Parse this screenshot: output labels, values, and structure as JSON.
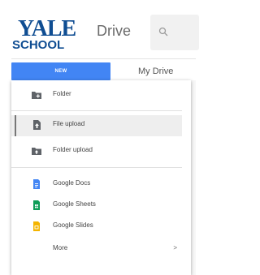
{
  "header": {
    "logo_line1": "YALE",
    "logo_line2": "SCHOOL",
    "app_name": "Drive",
    "search_icon": "search-icon"
  },
  "toolbar": {
    "new_label": "NEW",
    "my_drive_label": "My Drive",
    "accent_color": "#4285f4"
  },
  "menu": {
    "items": [
      {
        "label": "Folder",
        "icon": "folder-plus-icon"
      },
      {
        "label": "File upload",
        "icon": "file-upload-icon",
        "selected": true
      },
      {
        "label": "Folder upload",
        "icon": "folder-upload-icon"
      },
      {
        "label": "Google Docs",
        "icon": "google-docs-icon",
        "color": "#4285f4"
      },
      {
        "label": "Google Sheets",
        "icon": "google-sheets-icon",
        "color": "#0f9d58"
      },
      {
        "label": "Google Slides",
        "icon": "google-slides-icon",
        "color": "#f4b400"
      },
      {
        "label": "More",
        "icon": "chevron-right-icon",
        "chevron": ">"
      }
    ]
  }
}
